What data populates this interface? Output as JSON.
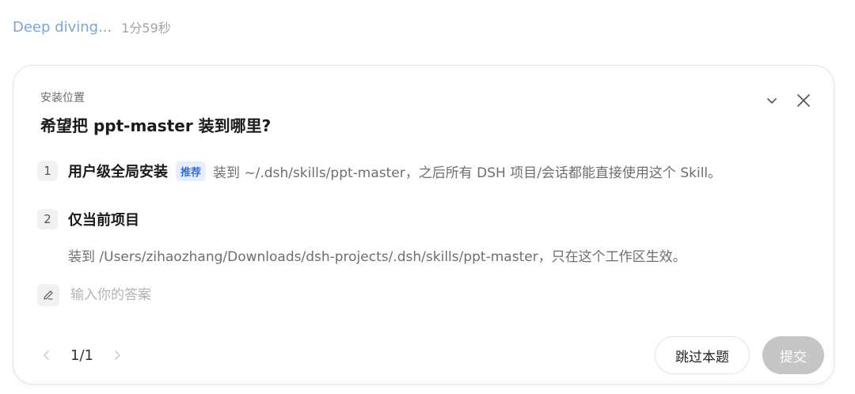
{
  "status": {
    "text": "Deep diving...",
    "elapsed": "1分59秒"
  },
  "card": {
    "section_label": "安装位置",
    "question": "希望把 ppt-master 装到哪里?",
    "options": [
      {
        "number": "1",
        "title": "用户级全局安装",
        "badge": "推荐",
        "description": "装到 ~/.dsh/skills/ppt-master，之后所有 DSH 项目/会话都能直接使用这个 Skill。"
      },
      {
        "number": "2",
        "title": "仅当前项目",
        "description": "装到 /Users/zihaozhang/Downloads/dsh-projects/.dsh/skills/ppt-master，只在这个工作区生效。"
      }
    ],
    "answer": {
      "placeholder": "输入你的答案",
      "value": ""
    },
    "pager": {
      "text": "1/1"
    },
    "buttons": {
      "skip": "跳过本题",
      "submit": "提交"
    },
    "icons": {
      "collapse": "chevron-down-icon",
      "close": "close-icon",
      "edit": "pencil-icon",
      "prev": "chevron-left-icon",
      "next": "chevron-right-icon"
    },
    "colors": {
      "status_text": "#7ba4db",
      "badge_bg": "#e7efff",
      "badge_text": "#3a6fd8",
      "submit_disabled": "#c6c6c6"
    }
  }
}
